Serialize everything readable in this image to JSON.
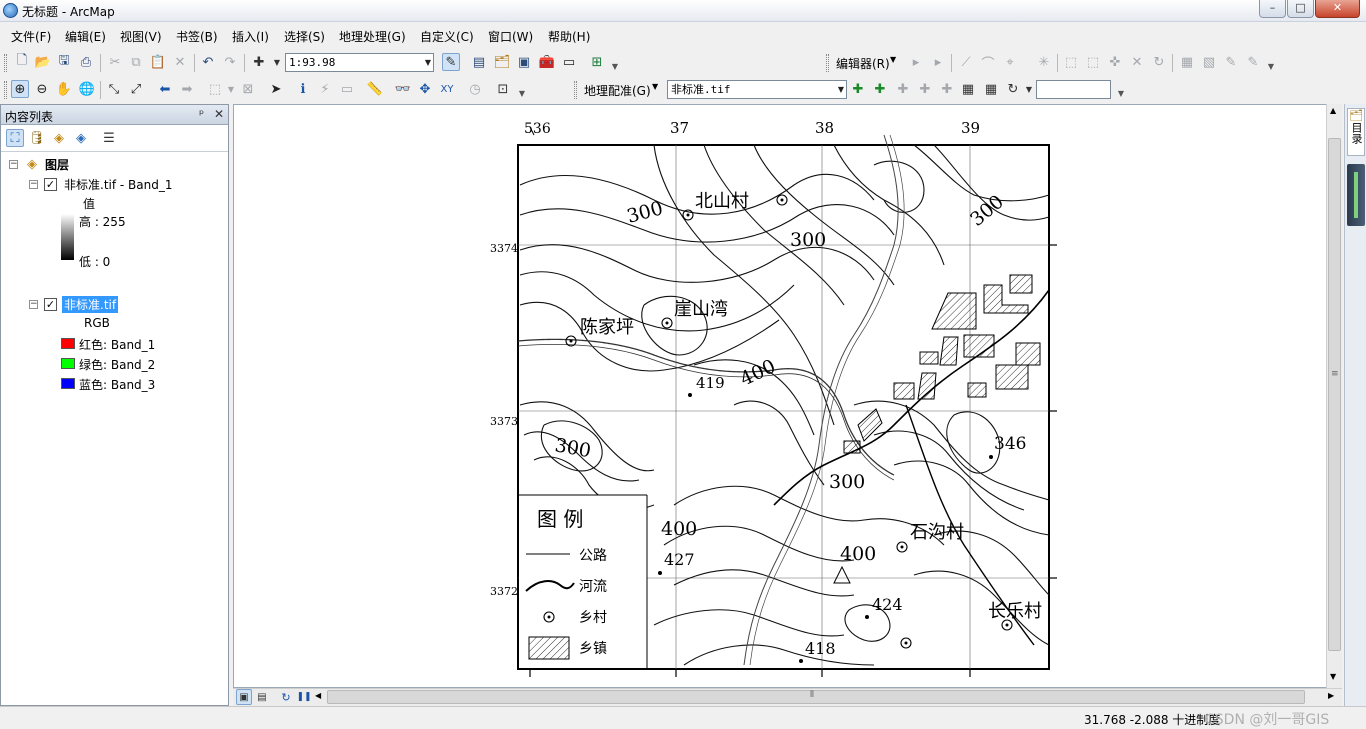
{
  "window": {
    "title": "无标题 - ArcMap",
    "min_label": "–",
    "max_label": "□",
    "close_label": "✕"
  },
  "menu": [
    "文件(F)",
    "编辑(E)",
    "视图(V)",
    "书签(B)",
    "插入(I)",
    "选择(S)",
    "地理处理(G)",
    "自定义(C)",
    "窗口(W)",
    "帮助(H)"
  ],
  "toolbar": {
    "scale": "1:93.98",
    "editor_label": "编辑器(R)",
    "georef_label": "地理配准(G)",
    "georef_layer": "非标准.tif",
    "georef_input": ""
  },
  "toc": {
    "title": "内容列表",
    "pin": "ᵖ",
    "close": "✕",
    "root_label": "图层",
    "layer1": {
      "name": "非标准.tif - Band_1",
      "checked": true,
      "value_label": "值",
      "high": "高 : 255",
      "low": "低 : 0"
    },
    "layer2": {
      "name": "非标准.tif",
      "checked": true,
      "mode": "RGB",
      "bands": [
        {
          "label": "红色:    Band_1",
          "color": "#ff0000"
        },
        {
          "label": "绿色: Band_2",
          "color": "#00ff00"
        },
        {
          "label": "蓝色:    Band_3",
          "color": "#0000ff"
        }
      ]
    }
  },
  "map": {
    "top_ticks": [
      "536",
      "37",
      "38",
      "39"
    ],
    "left_ticks": [
      "3374",
      "3373",
      "3372"
    ],
    "contours": [
      "300",
      "300",
      "300",
      "400",
      "419",
      "300",
      "346",
      "300",
      "400",
      "427",
      "400",
      "424",
      "418"
    ],
    "places": [
      "北山村",
      "崖山湾",
      "陈家坪",
      "石沟村",
      "长乐村"
    ],
    "legend": {
      "title": "图  例",
      "items": [
        "公路",
        "河流",
        "乡村",
        "乡镇"
      ]
    }
  },
  "dock": {
    "catalog": "目录"
  },
  "status": {
    "coords": "31.768   -2.088 十进制度",
    "watermark": "CSDN @刘一哥GIS"
  }
}
